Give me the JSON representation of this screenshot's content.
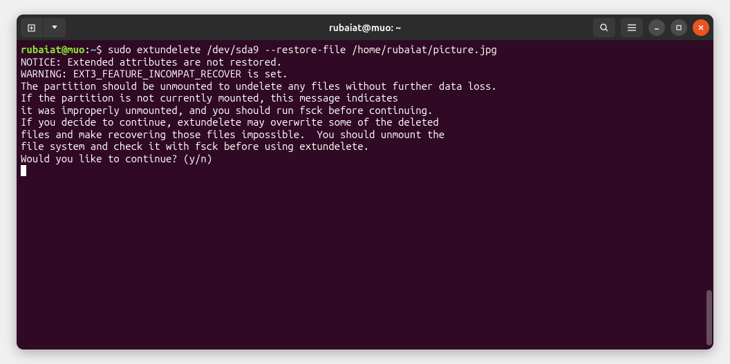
{
  "window": {
    "title": "rubaiat@muo: ~"
  },
  "prompt": {
    "user": "rubaiat",
    "at": "@",
    "host": "muo",
    "colon": ":",
    "path": "~",
    "dollar": "$"
  },
  "command": " sudo extundelete /dev/sda9 --restore-file /home/rubaiat/picture.jpg",
  "lines": [
    "NOTICE: Extended attributes are not restored.",
    "WARNING: EXT3_FEATURE_INCOMPAT_RECOVER is set.",
    "The partition should be unmounted to undelete any files without further data loss.",
    "If the partition is not currently mounted, this message indicates",
    "it was improperly unmounted, and you should run fsck before continuing.",
    "If you decide to continue, extundelete may overwrite some of the deleted",
    "files and make recovering those files impossible.  You should unmount the",
    "file system and check it with fsck before using extundelete.",
    "Would you like to continue? (y/n)"
  ]
}
